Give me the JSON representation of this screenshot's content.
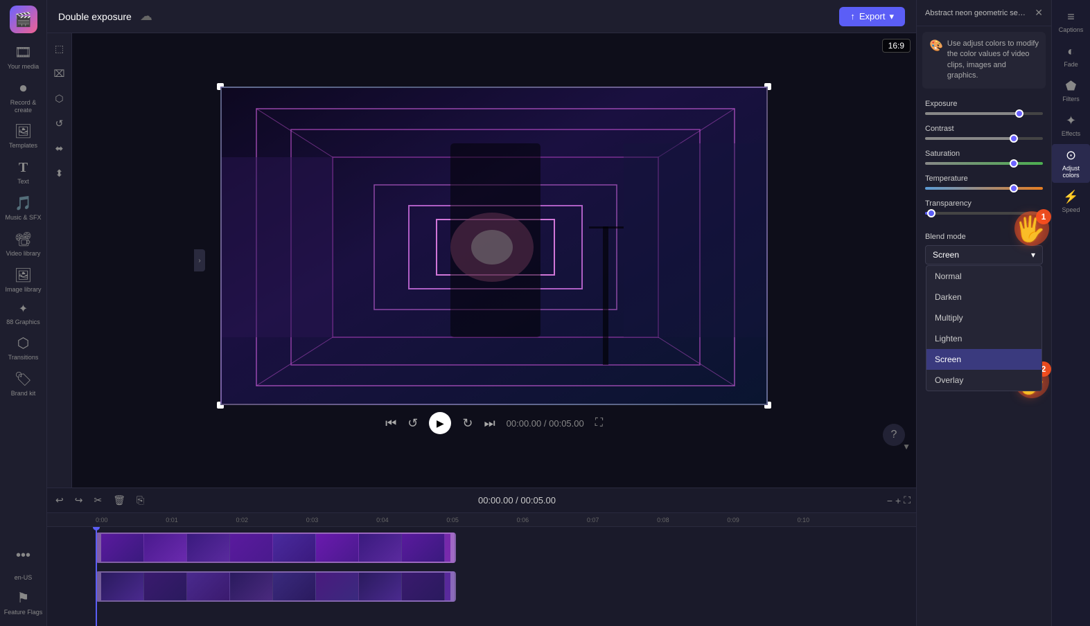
{
  "app": {
    "logo": "🎬",
    "title": "Double exposure",
    "cloud_icon": "☁"
  },
  "topbar": {
    "title": "Double exposure",
    "export_label": "Export",
    "export_icon": "↑"
  },
  "sidebar": {
    "items": [
      {
        "id": "your-media",
        "icon": "🎞",
        "label": "Your media"
      },
      {
        "id": "record-create",
        "icon": "⏺",
        "label": "Record &\ncreate"
      },
      {
        "id": "templates",
        "icon": "🖼",
        "label": "Templates"
      },
      {
        "id": "text",
        "icon": "T",
        "label": "Text"
      },
      {
        "id": "music-sfx",
        "icon": "🎵",
        "label": "Music & SFX"
      },
      {
        "id": "video-library",
        "icon": "📽",
        "label": "Video library"
      },
      {
        "id": "image-library",
        "icon": "🖼",
        "label": "Image library"
      },
      {
        "id": "graphics",
        "icon": "✦",
        "label": "88 Graphics"
      },
      {
        "id": "transitions",
        "icon": "⬡",
        "label": "Transitions"
      },
      {
        "id": "brand-kit",
        "icon": "🏷",
        "label": "Brand kit"
      }
    ],
    "more_label": "...",
    "lang_label": "en-US",
    "feature_label": "Feature Flags"
  },
  "left_toolbar": {
    "tools": [
      {
        "id": "select",
        "icon": "⬚"
      },
      {
        "id": "crop",
        "icon": "⌧"
      },
      {
        "id": "mask",
        "icon": "⬡"
      },
      {
        "id": "rotate",
        "icon": "↺"
      },
      {
        "id": "flip",
        "icon": "⬌"
      },
      {
        "id": "align",
        "icon": "⬍"
      }
    ]
  },
  "preview": {
    "aspect_ratio": "16:9",
    "time_current": "00:00.00",
    "time_total": "00:05.00"
  },
  "playback": {
    "skip_back": "⏮",
    "rewind": "↺",
    "play": "▶",
    "forward": "↻",
    "skip_forward": "⏭",
    "fullscreen": "⛶",
    "question": "?"
  },
  "timeline": {
    "toolbar": {
      "undo": "↩",
      "redo": "↪",
      "cut": "✂",
      "delete": "🗑",
      "copy": "⎘"
    },
    "time_display": "00:00.00 / 00:05.00",
    "zoom_in": "+",
    "zoom_out": "−",
    "expand": "⛶",
    "ruler_marks": [
      "0:00",
      "0:01",
      "0:02",
      "0:03",
      "0:04",
      "0:05",
      "0:06",
      "0:07",
      "0:08",
      "0:09",
      "0:10"
    ]
  },
  "right_panel": {
    "panel_title": "Abstract neon geometric seam...",
    "close_icon": "✕",
    "tip": {
      "emoji": "🎨",
      "text": "Use adjust colors to modify the color values of video clips, images and graphics."
    },
    "sliders": {
      "exposure": {
        "label": "Exposure",
        "value": 80
      },
      "contrast": {
        "label": "Contrast",
        "value": 75
      },
      "saturation": {
        "label": "Saturation",
        "value": 75
      },
      "temperature": {
        "label": "Temperature",
        "value": 75
      },
      "transparency": {
        "label": "Transparency",
        "value": 5
      }
    },
    "blend_mode": {
      "label": "Blend mode",
      "current": "Screen",
      "options": [
        {
          "id": "normal",
          "label": "Normal",
          "active": false
        },
        {
          "id": "darken",
          "label": "Darken",
          "active": false
        },
        {
          "id": "multiply",
          "label": "Multiply",
          "active": false
        },
        {
          "id": "lighten",
          "label": "Lighten",
          "active": false
        },
        {
          "id": "screen",
          "label": "Screen",
          "active": true
        },
        {
          "id": "overlay",
          "label": "Overlay",
          "active": false
        }
      ]
    },
    "expand_arrow": "▼"
  },
  "far_right": {
    "items": [
      {
        "id": "captions",
        "icon": "≡",
        "label": "Captions"
      },
      {
        "id": "fade",
        "icon": "◐",
        "label": "Fade"
      },
      {
        "id": "filters",
        "icon": "⬟",
        "label": "Filters"
      },
      {
        "id": "effects",
        "icon": "✦",
        "label": "Effects"
      },
      {
        "id": "adjust-colors",
        "icon": "⊙",
        "label": "Adjust colors"
      },
      {
        "id": "speed",
        "icon": "⚡",
        "label": "Speed"
      }
    ]
  },
  "annotations": {
    "cursor_1_number": "1",
    "cursor_2_number": "2"
  }
}
